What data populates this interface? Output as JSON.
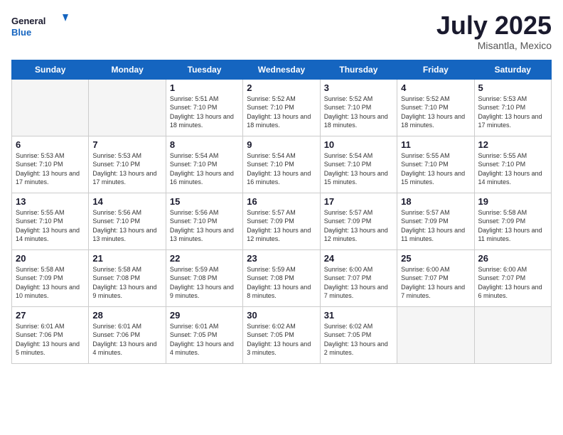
{
  "header": {
    "logo_line1": "General",
    "logo_line2": "Blue",
    "month": "July 2025",
    "location": "Misantla, Mexico"
  },
  "days_of_week": [
    "Sunday",
    "Monday",
    "Tuesday",
    "Wednesday",
    "Thursday",
    "Friday",
    "Saturday"
  ],
  "weeks": [
    [
      {
        "day": "",
        "empty": true
      },
      {
        "day": "",
        "empty": true
      },
      {
        "day": "1",
        "sunrise": "5:51 AM",
        "sunset": "7:10 PM",
        "daylight": "13 hours and 18 minutes."
      },
      {
        "day": "2",
        "sunrise": "5:52 AM",
        "sunset": "7:10 PM",
        "daylight": "13 hours and 18 minutes."
      },
      {
        "day": "3",
        "sunrise": "5:52 AM",
        "sunset": "7:10 PM",
        "daylight": "13 hours and 18 minutes."
      },
      {
        "day": "4",
        "sunrise": "5:52 AM",
        "sunset": "7:10 PM",
        "daylight": "13 hours and 18 minutes."
      },
      {
        "day": "5",
        "sunrise": "5:53 AM",
        "sunset": "7:10 PM",
        "daylight": "13 hours and 17 minutes."
      }
    ],
    [
      {
        "day": "6",
        "sunrise": "5:53 AM",
        "sunset": "7:10 PM",
        "daylight": "13 hours and 17 minutes."
      },
      {
        "day": "7",
        "sunrise": "5:53 AM",
        "sunset": "7:10 PM",
        "daylight": "13 hours and 17 minutes."
      },
      {
        "day": "8",
        "sunrise": "5:54 AM",
        "sunset": "7:10 PM",
        "daylight": "13 hours and 16 minutes."
      },
      {
        "day": "9",
        "sunrise": "5:54 AM",
        "sunset": "7:10 PM",
        "daylight": "13 hours and 16 minutes."
      },
      {
        "day": "10",
        "sunrise": "5:54 AM",
        "sunset": "7:10 PM",
        "daylight": "13 hours and 15 minutes."
      },
      {
        "day": "11",
        "sunrise": "5:55 AM",
        "sunset": "7:10 PM",
        "daylight": "13 hours and 15 minutes."
      },
      {
        "day": "12",
        "sunrise": "5:55 AM",
        "sunset": "7:10 PM",
        "daylight": "13 hours and 14 minutes."
      }
    ],
    [
      {
        "day": "13",
        "sunrise": "5:55 AM",
        "sunset": "7:10 PM",
        "daylight": "13 hours and 14 minutes."
      },
      {
        "day": "14",
        "sunrise": "5:56 AM",
        "sunset": "7:10 PM",
        "daylight": "13 hours and 13 minutes."
      },
      {
        "day": "15",
        "sunrise": "5:56 AM",
        "sunset": "7:10 PM",
        "daylight": "13 hours and 13 minutes."
      },
      {
        "day": "16",
        "sunrise": "5:57 AM",
        "sunset": "7:09 PM",
        "daylight": "13 hours and 12 minutes."
      },
      {
        "day": "17",
        "sunrise": "5:57 AM",
        "sunset": "7:09 PM",
        "daylight": "13 hours and 12 minutes."
      },
      {
        "day": "18",
        "sunrise": "5:57 AM",
        "sunset": "7:09 PM",
        "daylight": "13 hours and 11 minutes."
      },
      {
        "day": "19",
        "sunrise": "5:58 AM",
        "sunset": "7:09 PM",
        "daylight": "13 hours and 11 minutes."
      }
    ],
    [
      {
        "day": "20",
        "sunrise": "5:58 AM",
        "sunset": "7:09 PM",
        "daylight": "13 hours and 10 minutes."
      },
      {
        "day": "21",
        "sunrise": "5:58 AM",
        "sunset": "7:08 PM",
        "daylight": "13 hours and 9 minutes."
      },
      {
        "day": "22",
        "sunrise": "5:59 AM",
        "sunset": "7:08 PM",
        "daylight": "13 hours and 9 minutes."
      },
      {
        "day": "23",
        "sunrise": "5:59 AM",
        "sunset": "7:08 PM",
        "daylight": "13 hours and 8 minutes."
      },
      {
        "day": "24",
        "sunrise": "6:00 AM",
        "sunset": "7:07 PM",
        "daylight": "13 hours and 7 minutes."
      },
      {
        "day": "25",
        "sunrise": "6:00 AM",
        "sunset": "7:07 PM",
        "daylight": "13 hours and 7 minutes."
      },
      {
        "day": "26",
        "sunrise": "6:00 AM",
        "sunset": "7:07 PM",
        "daylight": "13 hours and 6 minutes."
      }
    ],
    [
      {
        "day": "27",
        "sunrise": "6:01 AM",
        "sunset": "7:06 PM",
        "daylight": "13 hours and 5 minutes."
      },
      {
        "day": "28",
        "sunrise": "6:01 AM",
        "sunset": "7:06 PM",
        "daylight": "13 hours and 4 minutes."
      },
      {
        "day": "29",
        "sunrise": "6:01 AM",
        "sunset": "7:05 PM",
        "daylight": "13 hours and 4 minutes."
      },
      {
        "day": "30",
        "sunrise": "6:02 AM",
        "sunset": "7:05 PM",
        "daylight": "13 hours and 3 minutes."
      },
      {
        "day": "31",
        "sunrise": "6:02 AM",
        "sunset": "7:05 PM",
        "daylight": "13 hours and 2 minutes."
      },
      {
        "day": "",
        "empty": true
      },
      {
        "day": "",
        "empty": true
      }
    ]
  ],
  "labels": {
    "sunrise_prefix": "Sunrise: ",
    "sunset_prefix": "Sunset: ",
    "daylight_prefix": "Daylight: "
  }
}
